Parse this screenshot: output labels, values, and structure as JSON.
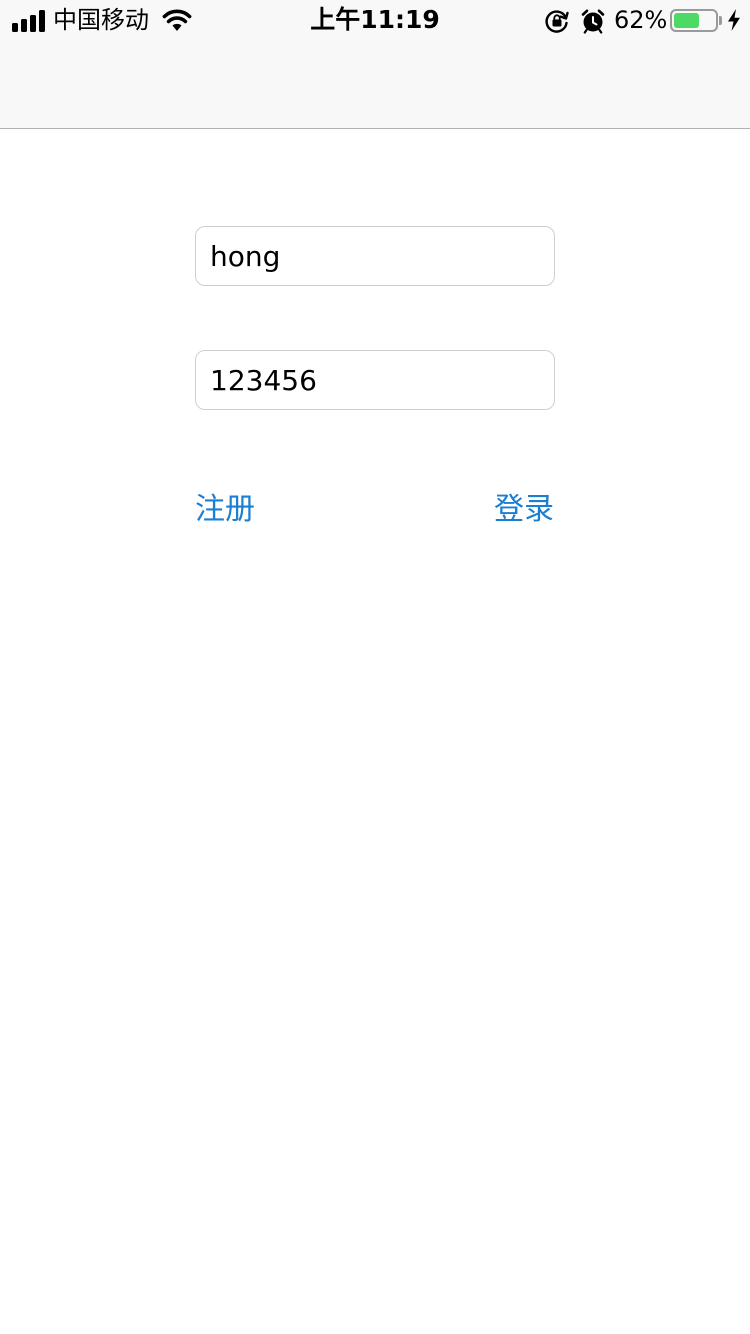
{
  "status_bar": {
    "carrier": "中国移动",
    "time": "上午11:19",
    "battery_percent": "62%",
    "battery_level": 0.62,
    "icons": [
      "signal-icon",
      "wifi-icon",
      "orientation-lock-icon",
      "alarm-icon",
      "battery-icon",
      "charging-icon"
    ]
  },
  "form": {
    "username_value": "hong",
    "password_value": "123456"
  },
  "actions": {
    "register_label": "注册",
    "login_label": "登录"
  },
  "colors": {
    "link": "#1a7fd3",
    "battery": "#4cd964",
    "nav_background": "#f8f8f8"
  }
}
